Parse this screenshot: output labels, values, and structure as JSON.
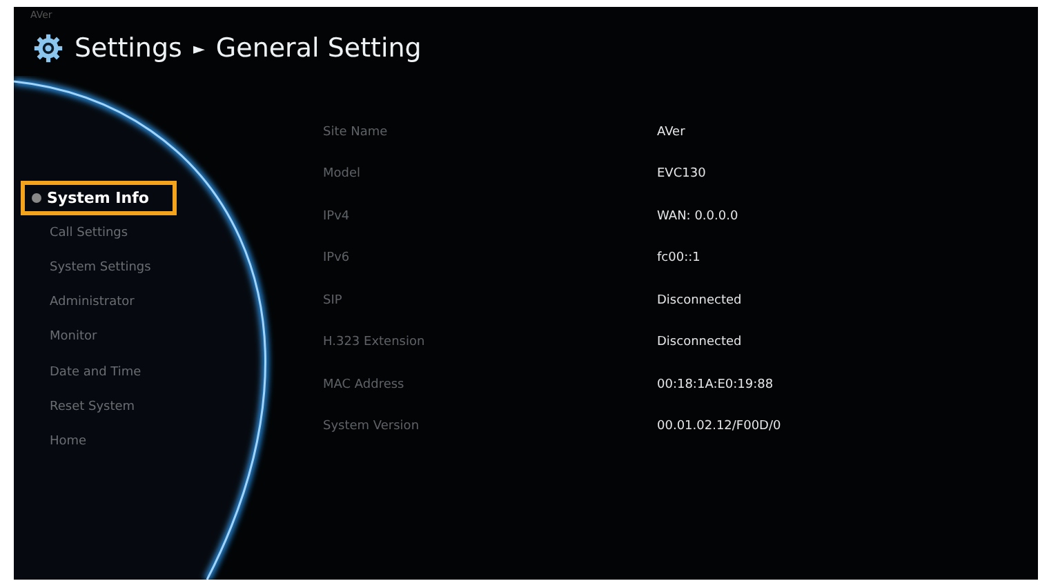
{
  "logo": "AVer",
  "breadcrumb": {
    "root": "Settings",
    "separator": "►",
    "current": "General Setting"
  },
  "menu": [
    {
      "label": "System Info",
      "selected": true
    },
    {
      "label": "Call Settings",
      "selected": false
    },
    {
      "label": "System Settings",
      "selected": false
    },
    {
      "label": "Administrator",
      "selected": false
    },
    {
      "label": "Monitor",
      "selected": false
    },
    {
      "label": "Date and Time",
      "selected": false
    },
    {
      "label": "Reset System",
      "selected": false
    },
    {
      "label": "Home",
      "selected": false
    }
  ],
  "info": [
    {
      "label": "Site Name",
      "value": "AVer"
    },
    {
      "label": "Model",
      "value": "EVC130"
    },
    {
      "label": "IPv4",
      "value": "WAN: 0.0.0.0"
    },
    {
      "label": "IPv6",
      "value": "fc00::1"
    },
    {
      "label": "SIP",
      "value": "Disconnected"
    },
    {
      "label": "H.323 Extension",
      "value": "Disconnected"
    },
    {
      "label": "MAC Address",
      "value": "00:18:1A:E0:19:88"
    },
    {
      "label": "System Version",
      "value": "00.01.02.12/F00D/0"
    }
  ]
}
